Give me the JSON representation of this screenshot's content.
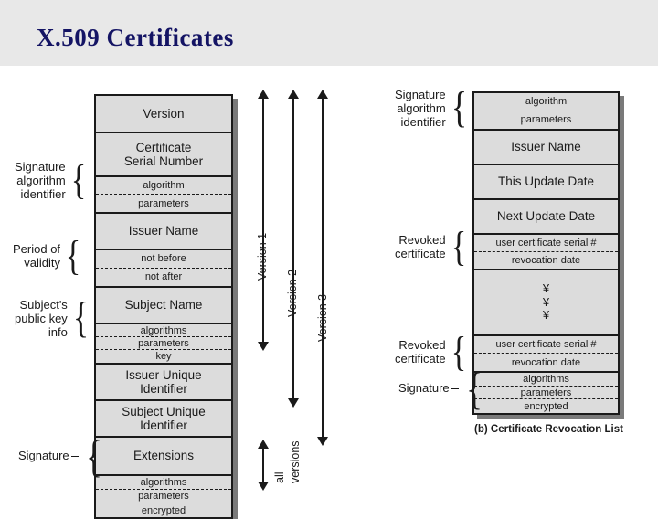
{
  "header": {
    "title": "X.509 Certificates",
    "background_color": "#e8e8e8",
    "title_color": "#141464"
  },
  "colors": {
    "box_fill": "#dcdcdc",
    "box_border": "#1a1a1a",
    "shadow": "#7a7a7a",
    "page_background": "#ffffff"
  },
  "certificate": {
    "fields": [
      {
        "id": "version",
        "lines": [
          "Version"
        ]
      },
      {
        "id": "serial-number",
        "lines": [
          "Certificate",
          "Serial Number"
        ]
      },
      {
        "id": "signature-algorithm",
        "subfields": [
          "algorithm",
          "parameters"
        ]
      },
      {
        "id": "issuer-name",
        "lines": [
          "Issuer Name"
        ]
      },
      {
        "id": "validity",
        "subfields": [
          "not before",
          "not after"
        ]
      },
      {
        "id": "subject-name",
        "lines": [
          "Subject Name"
        ]
      },
      {
        "id": "subject-public-key",
        "subfields": [
          "algorithms",
          "parameters",
          "key"
        ]
      },
      {
        "id": "issuer-unique-id",
        "lines": [
          "Issuer Unique",
          "Identifier"
        ]
      },
      {
        "id": "subject-unique-id",
        "lines": [
          "Subject Unique",
          "Identifier"
        ]
      },
      {
        "id": "extensions",
        "lines": [
          "Extensions"
        ]
      },
      {
        "id": "signature",
        "subfields": [
          "algorithms",
          "parameters",
          "encrypted"
        ]
      }
    ],
    "side_labels": [
      {
        "id": "signature-algorithm-identifier",
        "lines": [
          "Signature",
          "algorithm",
          "identifier"
        ]
      },
      {
        "id": "period-of-validity",
        "lines": [
          "Period of",
          "validity"
        ]
      },
      {
        "id": "subjects-public-key-info",
        "lines": [
          "Subject's",
          "public key",
          "info"
        ]
      },
      {
        "id": "signature",
        "lines": [
          "Signature"
        ]
      }
    ]
  },
  "versions": {
    "arrows": [
      {
        "id": "version-1",
        "label": "Version 1"
      },
      {
        "id": "version-2",
        "label": "Version 2"
      },
      {
        "id": "version-3",
        "label": "Version 3"
      },
      {
        "id": "all-versions",
        "label_line_1": "all",
        "label_line_2": "versions"
      }
    ]
  },
  "crl": {
    "caption": "(b) Certificate Revocation List",
    "fields": [
      {
        "id": "signature-algorithm",
        "subfields": [
          "algorithm",
          "parameters"
        ]
      },
      {
        "id": "issuer-name",
        "lines": [
          "Issuer Name"
        ]
      },
      {
        "id": "this-update-date",
        "lines": [
          "This Update Date"
        ]
      },
      {
        "id": "next-update-date",
        "lines": [
          "Next Update Date"
        ]
      },
      {
        "id": "revoked-certificate-1",
        "subfields": [
          "user certificate serial #",
          "revocation date"
        ]
      },
      {
        "id": "ellipsis",
        "dots": [
          "¥",
          "¥",
          "¥"
        ]
      },
      {
        "id": "revoked-certificate-2",
        "subfields": [
          "user certificate serial #",
          "revocation date"
        ]
      },
      {
        "id": "signature",
        "subfields": [
          "algorithms",
          "parameters",
          "encrypted"
        ]
      }
    ],
    "side_labels": [
      {
        "id": "signature-algorithm-identifier",
        "lines": [
          "Signature",
          "algorithm",
          "identifier"
        ]
      },
      {
        "id": "revoked-certificate-1",
        "lines": [
          "Revoked",
          "certificate"
        ]
      },
      {
        "id": "revoked-certificate-2",
        "lines": [
          "Revoked",
          "certificate"
        ]
      },
      {
        "id": "signature",
        "lines": [
          "Signature"
        ]
      }
    ]
  }
}
